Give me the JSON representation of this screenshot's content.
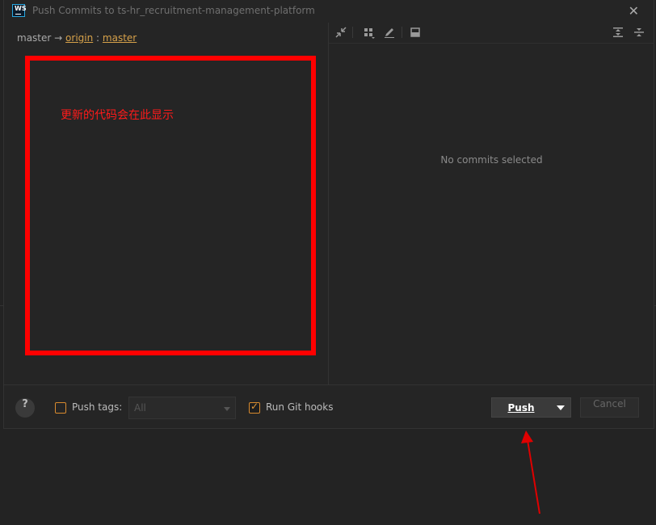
{
  "window": {
    "app_icon_text": "WS",
    "title": "Push Commits to ts-hr_recruitment-management-platform",
    "close_glyph": "✕"
  },
  "branch": {
    "local": "master",
    "arrow": "→",
    "remote": "origin",
    "separator": ":",
    "target": "master"
  },
  "annotation_text": "更新的代码会在此显示",
  "details": {
    "empty_text": "No commits selected"
  },
  "toolbar_icons": [
    "collapse-icon",
    "group-by-icon",
    "edit-icon",
    "preview-icon",
    "expand-all-icon",
    "collapse-all-icon"
  ],
  "footer": {
    "help_label": "?",
    "push_tags_label": "Push tags:",
    "push_tags_checked": false,
    "tags_select_value": "All",
    "run_hooks_label": "Run Git hooks",
    "run_hooks_checked": true,
    "push_label": "Push",
    "cancel_label": "Cancel"
  },
  "colors": {
    "background": "#232323",
    "accent_link": "#d6a14a",
    "checkbox_border": "#d88a2e",
    "annotation_red": "#ff0000"
  }
}
